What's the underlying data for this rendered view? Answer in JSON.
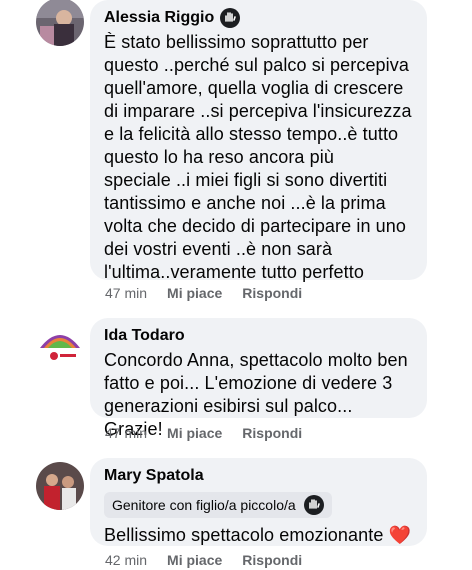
{
  "comments": [
    {
      "author": "Alessia Riggio",
      "lines": [
        "È stato bellissimo soprattutto per",
        "questo ..perché sul palco si percepiva",
        "quell'amore, quella voglia di crescere",
        "di imparare ..si percepiva l'insicurezza",
        "e la felicità allo stesso tempo..è tutto",
        "questo lo ha reso ancora più",
        "speciale ..i miei figli si sono divertiti",
        "tantissimo e anche noi ...è la prima",
        "volta che decido di partecipare in uno",
        "dei vostri eventi ..è non sarà",
        "l'ultima..veramente tutto perfetto"
      ],
      "time": "47 min",
      "like": "Mi piace",
      "reply": "Rispondi",
      "wave_icon": "wave-hand-icon"
    },
    {
      "author": "Ida Todaro",
      "lines": [
        "Concordo Anna, spettacolo molto ben",
        "fatto e poi... L'emozione di vedere 3",
        "generazioni esibirsi sul palco... Grazie!"
      ],
      "time": "47 min",
      "like": "Mi piace",
      "reply": "Rispondi"
    },
    {
      "author": "Mary Spatola",
      "badge": "Genitore con figlio/a piccolo/a",
      "lines": [
        "Bellissimo spettacolo emozionante"
      ],
      "emoji": "❤️",
      "time": "42 min",
      "like": "Mi piace",
      "reply": "Rispondi"
    }
  ],
  "colors": {
    "bubble": "#f0f2f5",
    "meta": "#65676b",
    "heart": "#e0245e"
  }
}
